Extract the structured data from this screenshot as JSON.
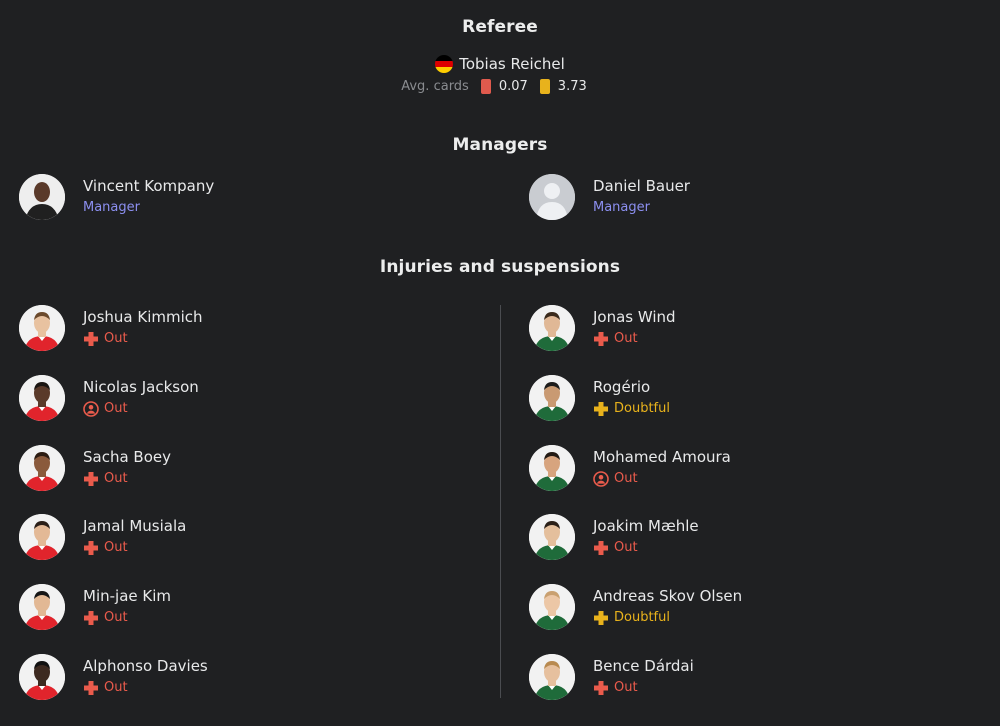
{
  "referee": {
    "title": "Referee",
    "name": "Tobias Reichel",
    "flag": "germany-flag",
    "avg_cards_label": "Avg. cards",
    "red_avg": "0.07",
    "yellow_avg": "3.73"
  },
  "managers": {
    "title": "Managers",
    "home": {
      "name": "Vincent Kompany",
      "role": "Manager"
    },
    "away": {
      "name": "Daniel Bauer",
      "role": "Manager"
    }
  },
  "injuries": {
    "title": "Injuries and suspensions",
    "home": [
      {
        "name": "Joshua Kimmich",
        "status": "Out",
        "icon": "injury-cross-icon"
      },
      {
        "name": "Nicolas Jackson",
        "status": "Out",
        "icon": "player-out-icon"
      },
      {
        "name": "Sacha Boey",
        "status": "Out",
        "icon": "injury-cross-icon"
      },
      {
        "name": "Jamal Musiala",
        "status": "Out",
        "icon": "injury-cross-icon"
      },
      {
        "name": "Min-jae Kim",
        "status": "Out",
        "icon": "injury-cross-icon"
      },
      {
        "name": "Alphonso Davies",
        "status": "Out",
        "icon": "injury-cross-icon"
      }
    ],
    "away": [
      {
        "name": "Jonas Wind",
        "status": "Out",
        "icon": "injury-cross-icon"
      },
      {
        "name": "Rogério",
        "status": "Doubtful",
        "icon": "injury-cross-icon"
      },
      {
        "name": "Mohamed Amoura",
        "status": "Out",
        "icon": "player-out-icon"
      },
      {
        "name": "Joakim Mæhle",
        "status": "Out",
        "icon": "injury-cross-icon"
      },
      {
        "name": "Andreas Skov Olsen",
        "status": "Doubtful",
        "icon": "injury-cross-icon"
      },
      {
        "name": "Bence Dárdai",
        "status": "Out",
        "icon": "injury-cross-icon"
      }
    ]
  },
  "colors": {
    "background": "#1f2022",
    "out": "#ea5b4c",
    "doubtful": "#e8b21c",
    "manager_role": "#8c8ff0",
    "home_kit": "#e1242c",
    "away_kit": "#1f6b3a"
  }
}
